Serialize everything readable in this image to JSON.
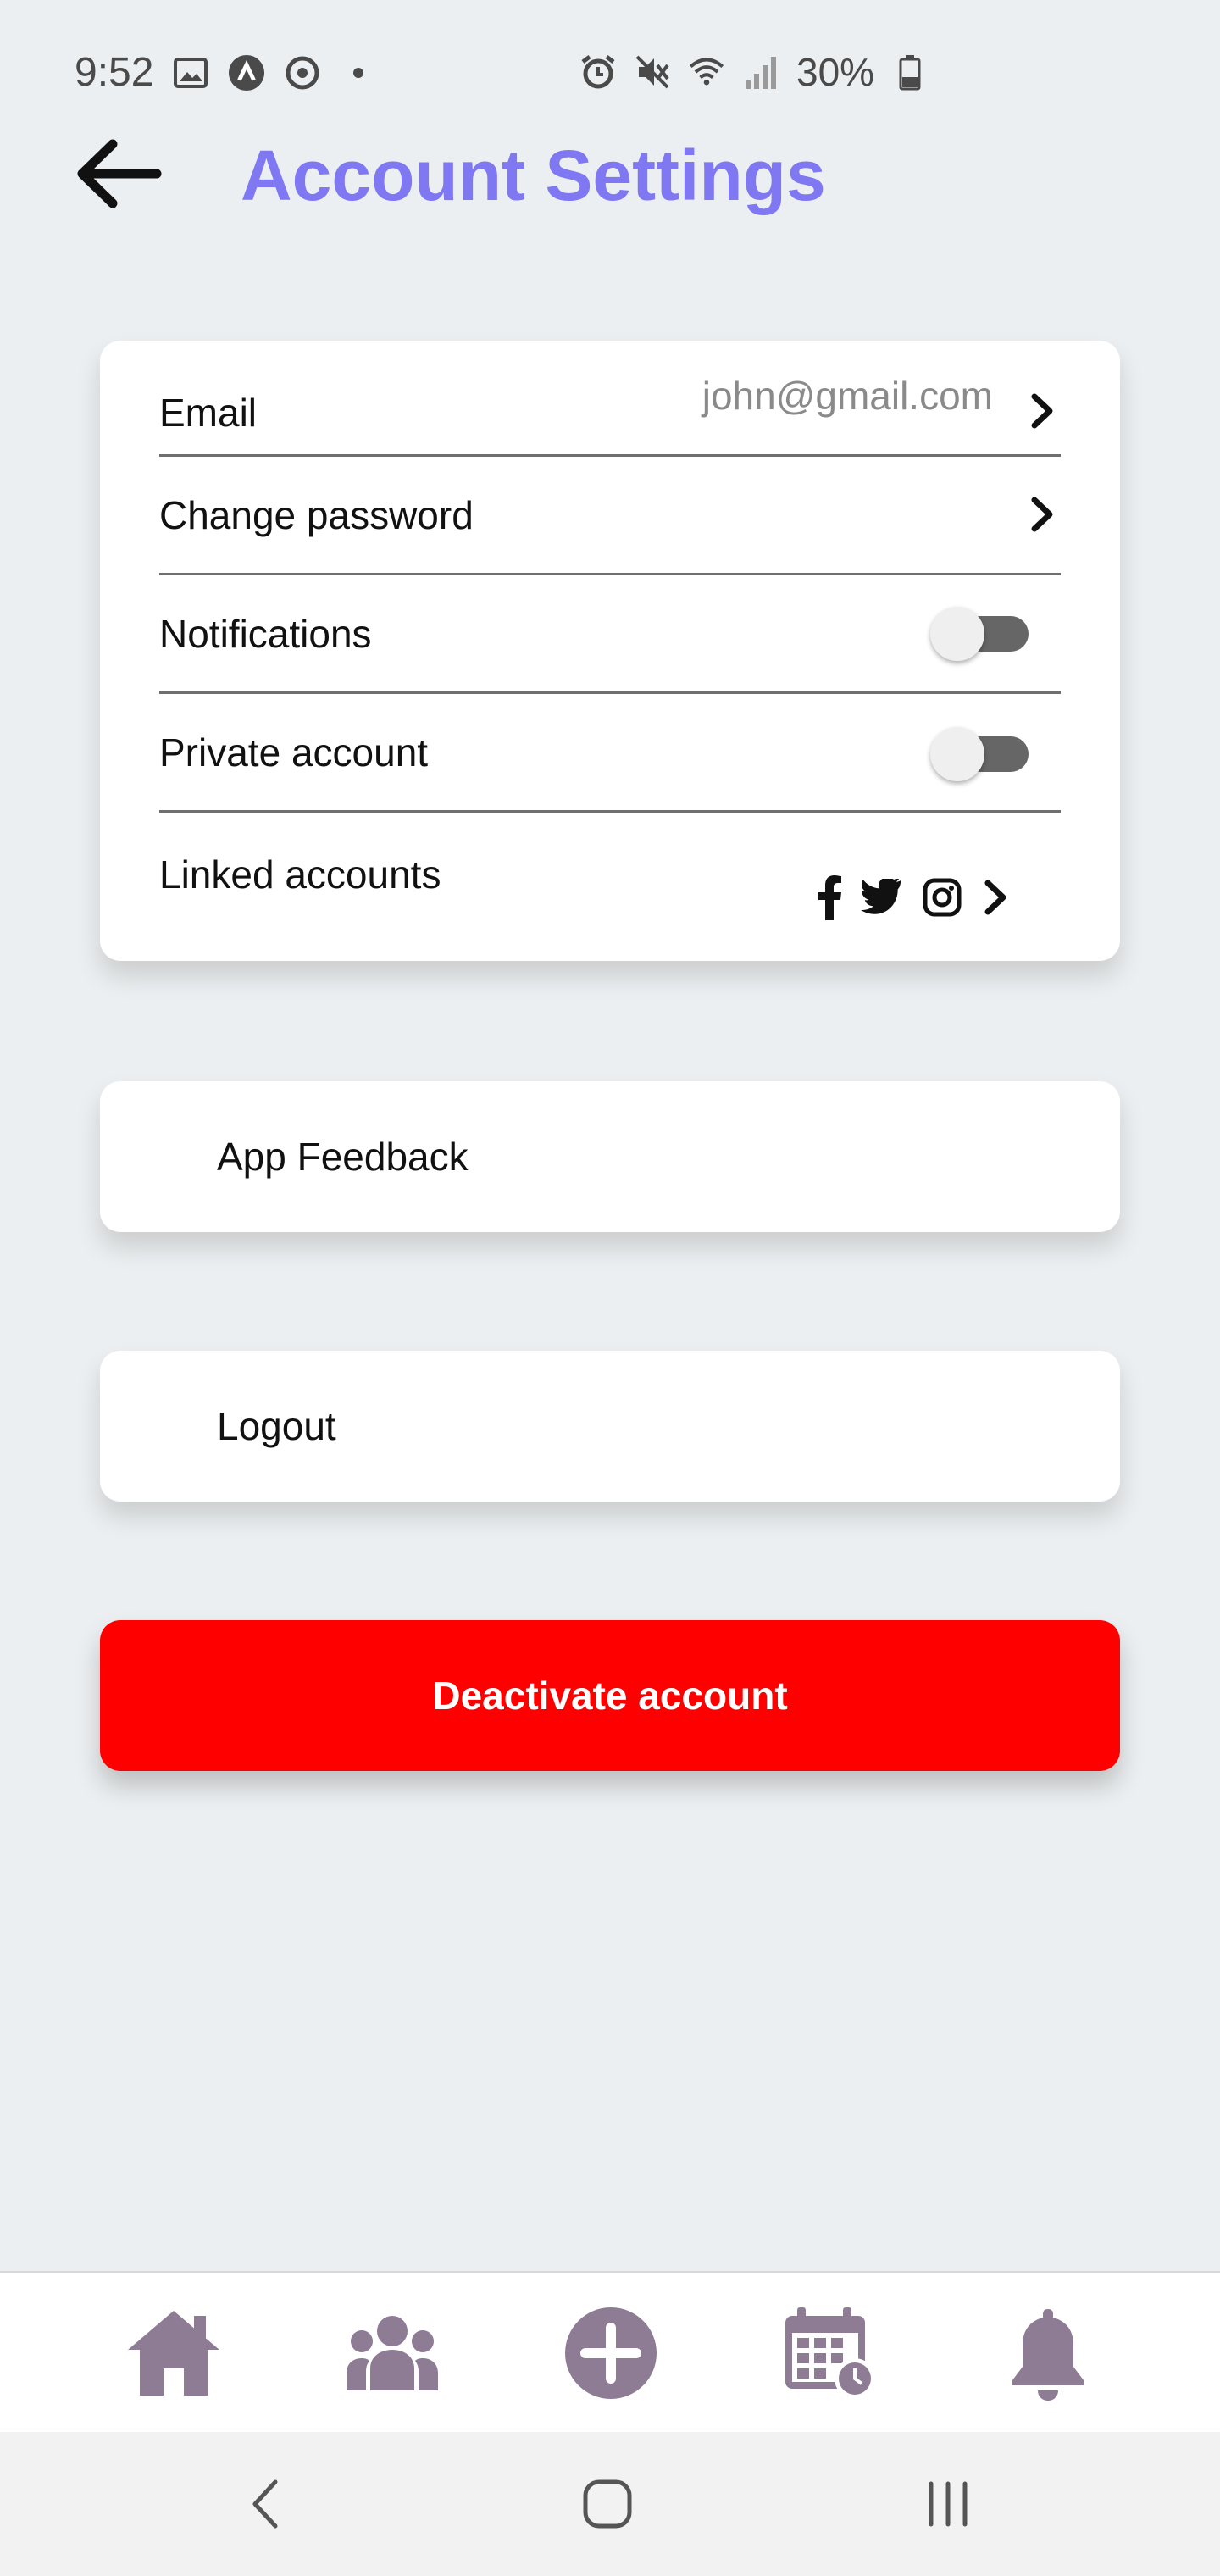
{
  "status_bar": {
    "time": "9:52",
    "battery": "30%",
    "icons_left": [
      "image-icon",
      "app-a-icon",
      "sync-icon",
      "dot-icon"
    ],
    "icons_right": [
      "alarm-icon",
      "mute-icon",
      "wifi-icon",
      "signal-icon",
      "battery-icon"
    ]
  },
  "header": {
    "title": "Account Settings",
    "back_icon": "arrow-left-icon"
  },
  "settings": {
    "email_label": "Email",
    "email_value": "john@gmail.com",
    "change_password_label": "Change password",
    "notifications_label": "Notifications",
    "notifications_on": false,
    "private_account_label": "Private account",
    "private_account_on": false,
    "linked_accounts_label": "Linked accounts",
    "linked_icons": [
      "facebook-icon",
      "twitter-icon",
      "instagram-icon"
    ]
  },
  "app_feedback_label": "App Feedback",
  "logout_label": "Logout",
  "deactivate_label": "Deactivate account",
  "bottom_nav": [
    "home-icon",
    "group-icon",
    "add-icon",
    "calendar-icon",
    "bell-icon"
  ],
  "system_nav": [
    "back-icon",
    "home-circle-icon",
    "recents-icon"
  ],
  "colors": {
    "accent": "#7f78f2",
    "danger": "#ff0000",
    "nav_icon": "#8e7b94",
    "background": "#eceff1"
  }
}
